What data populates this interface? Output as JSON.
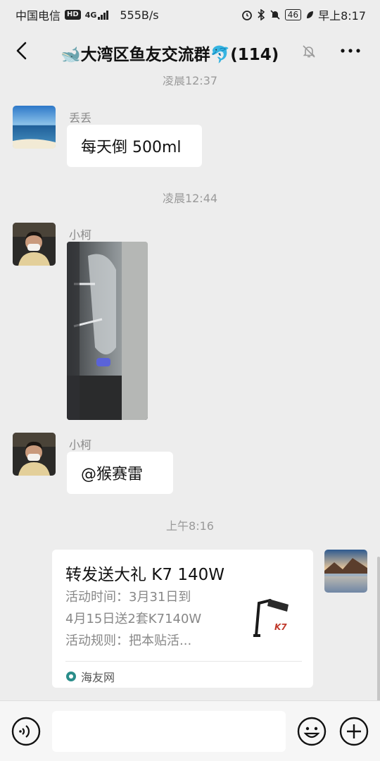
{
  "status": {
    "carrier": "中国电信",
    "hd": "HD",
    "net": "4G",
    "speed": "555B/s",
    "battery": "46",
    "time": "早上8:17"
  },
  "header": {
    "title": "🐋大湾区鱼友交流群🐬(114)"
  },
  "messages": {
    "t0": "凌晨12:37",
    "m1": {
      "nick": "丢丢",
      "text": "每天倒 500ml"
    },
    "t1": "凌晨12:44",
    "m2": {
      "nick": "小柯"
    },
    "m3": {
      "nick": "小柯",
      "text": "@猴赛雷"
    },
    "t2": "上午8:16",
    "card": {
      "title": "转发送大礼 K7 140W",
      "line1": "活动时间：3月31日到",
      "line2": "4月15日送2套K7140W",
      "line3": "活动规则：把本贴活...",
      "source": "海友网",
      "thumb_text": "K7"
    }
  },
  "colors": {
    "background": "#ededed",
    "bubble": "#ffffff",
    "timestamp": "#9a9a9a"
  }
}
